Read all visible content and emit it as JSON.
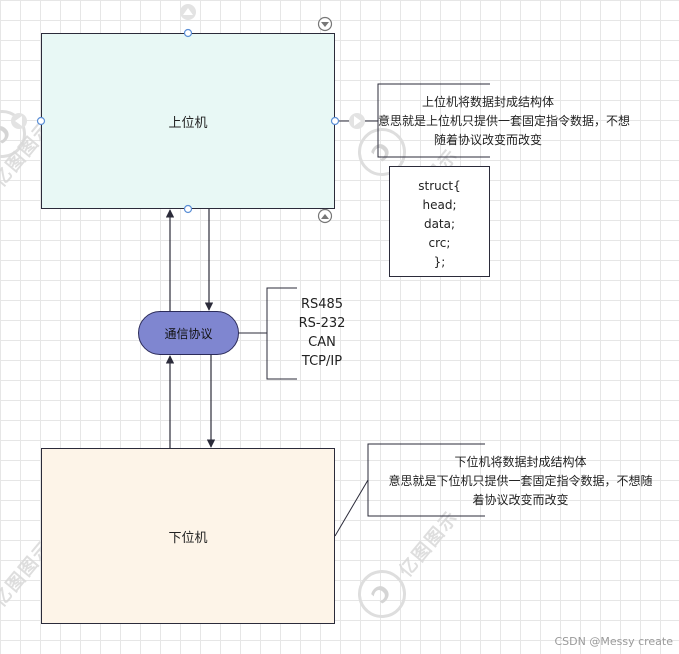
{
  "nodes": {
    "upper": "上位机",
    "lower": "下位机",
    "protocol": "通信协议"
  },
  "notes": {
    "upper_lines": [
      "上位机将数据封成结构体",
      "意思就是上位机只提供一套固定指令数据，不想",
      "随着协议改变而改变"
    ],
    "lower_lines": [
      "下位机将数据封成结构体",
      "意思就是下位机只提供一套固定指令数据，不想随",
      "着协议改变而改变"
    ]
  },
  "protocols": [
    "RS485",
    "RS-232",
    "CAN",
    "TCP/IP"
  ],
  "struct_lines": [
    "struct{",
    "head;",
    "data;",
    "crc;",
    "};"
  ],
  "watermark": "亿图图示",
  "credit": "CSDN @Messy create",
  "colors": {
    "upper_fill": "#e8f8f5",
    "lower_fill": "#fdf4e8",
    "pill_fill": "#7f86d0",
    "line": "#2b2b3a",
    "handle": "#5b8fd6"
  }
}
